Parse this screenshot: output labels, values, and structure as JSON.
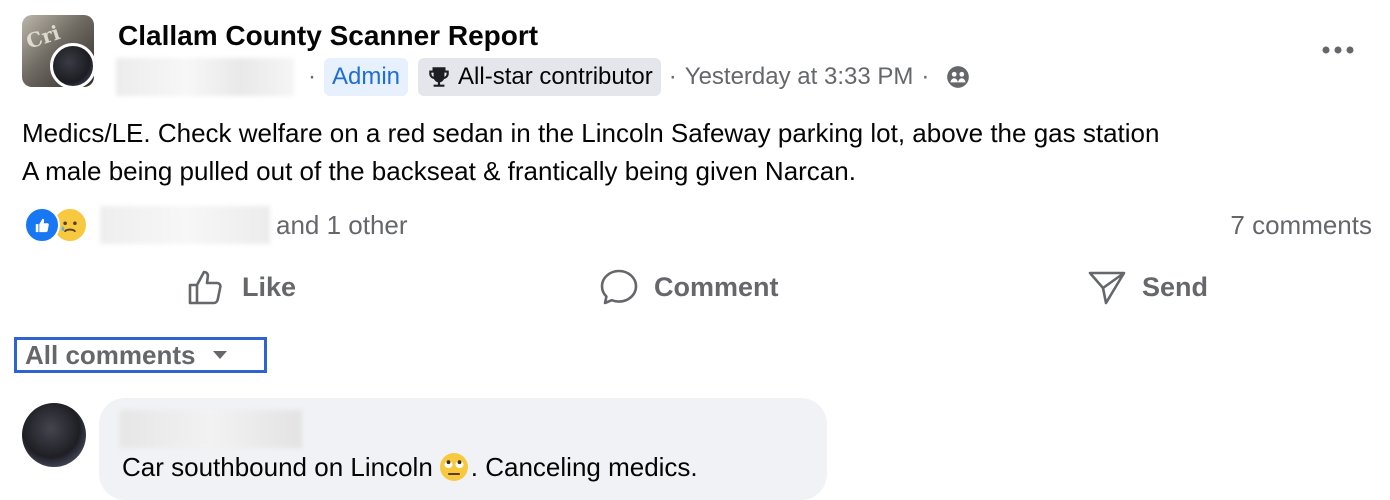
{
  "post": {
    "group_name": "Clallam County Scanner Report",
    "meta_separator": "·",
    "admin_badge": "Admin",
    "contributor_badge": "All-star contributor",
    "timestamp": "Yesterday at 3:33 PM",
    "text": "Medics/LE. Check welfare on a red sedan in the Lincoln Safeway parking lot, above the gas station\n A male being pulled out of the backseat & frantically being given Narcan.",
    "reactions_text": "and 1 other",
    "comments_count": "7 comments"
  },
  "actions": {
    "like_label": "Like",
    "comment_label": "Comment",
    "send_label": "Send"
  },
  "comments_filter": {
    "label": "All comments"
  },
  "comment": {
    "text_before_emoji": "Car southbound on Lincoln ",
    "text_after_emoji": ". Canceling medics."
  },
  "icons": {
    "trophy": "trophy-icon",
    "privacy": "group-members-icon",
    "more": "more-options-icon",
    "reaction_like": "like-reaction-icon",
    "reaction_sad": "sad-reaction-icon",
    "like": "thumbs-up-icon",
    "comment": "speech-bubble-icon",
    "send": "send-icon",
    "caret": "caret-down-icon",
    "eye_roll": "eye-roll-emoji-icon"
  },
  "colors": {
    "accent": "#1877f2",
    "admin_text": "#1e6ed6",
    "secondary_text": "#65676b",
    "highlight_border": "#2f63d1",
    "bubble": "#f0f2f5"
  }
}
